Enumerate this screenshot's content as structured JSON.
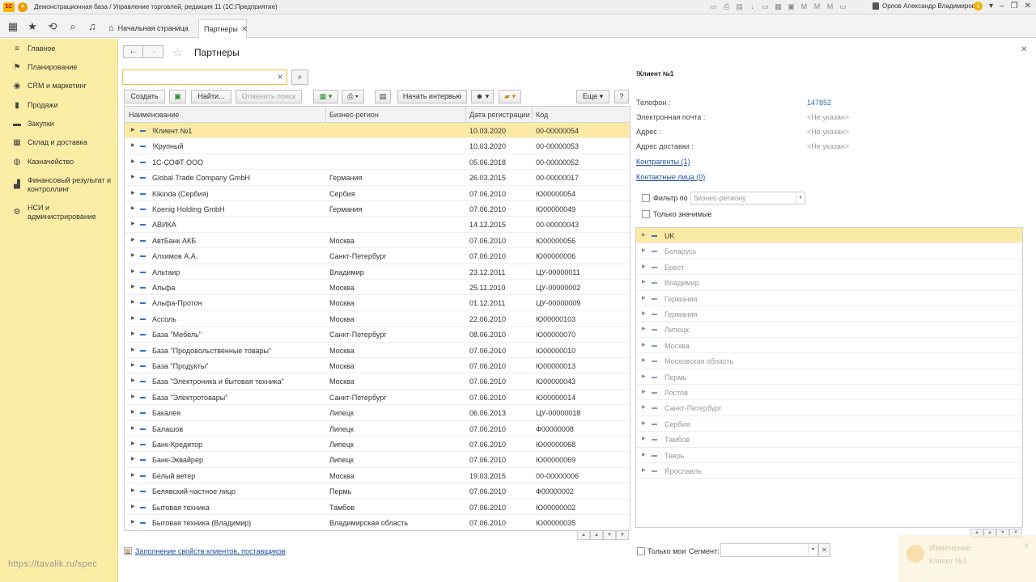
{
  "window": {
    "title": "Демонстрационная база / Управление торговлей, редакция 11  (1С:Предприятие)",
    "user": "Орлов Александр Владимирович"
  },
  "tabs": [
    {
      "label": "Начальная страница"
    },
    {
      "label": "Партнеры"
    }
  ],
  "sidebar": {
    "items": [
      {
        "label": "Главное",
        "icon": "menu-lines-icon"
      },
      {
        "label": "Планирование",
        "icon": "planning-icon"
      },
      {
        "label": "CRM и маркетинг",
        "icon": "crm-icon"
      },
      {
        "label": "Продажи",
        "icon": "sales-icon"
      },
      {
        "label": "Закупки",
        "icon": "purchases-icon"
      },
      {
        "label": "Склад и доставка",
        "icon": "warehouse-icon"
      },
      {
        "label": "Казначейство",
        "icon": "treasury-icon"
      },
      {
        "label": "Финансовый результат и контроллинг",
        "icon": "finance-icon"
      },
      {
        "label": "НСИ и администрирование",
        "icon": "settings-icon"
      }
    ],
    "watermark": "https://tavalik.ru/spec"
  },
  "form": {
    "title": "Партнеры",
    "search_value": "",
    "buttons": {
      "create": "Создать",
      "find": "Найти...",
      "cancel_search": "Отменить поиск",
      "start_interview": "Начать интервью",
      "more": "Еще",
      "help": "?"
    },
    "columns": [
      "Наименование",
      "Бизнес-регион",
      "Дата регистрации",
      "Код"
    ],
    "rows": [
      {
        "name": "!Клиент №1",
        "region": "",
        "date": "10.03.2020",
        "code": "00-00000054"
      },
      {
        "name": "!Крупный",
        "region": "",
        "date": "10.03.2020",
        "code": "00-00000053"
      },
      {
        "name": "1С-СОФТ ООО",
        "region": "",
        "date": "05.06.2018",
        "code": "00-00000052"
      },
      {
        "name": "Global Trade Company GmbH",
        "region": "Германия",
        "date": "26.03.2015",
        "code": "00-00000017"
      },
      {
        "name": "Kikinda (Сербия)",
        "region": "Сербия",
        "date": "07.06.2010",
        "code": "Ю00000054"
      },
      {
        "name": "Koenig Holding GmbH",
        "region": "Германия",
        "date": "07.06.2010",
        "code": "Ю00000049"
      },
      {
        "name": "АВИКА",
        "region": "",
        "date": "14.12.2015",
        "code": "00-00000043"
      },
      {
        "name": "АвтБанк АКБ",
        "region": "Москва",
        "date": "07.06.2010",
        "code": "Ю00000056"
      },
      {
        "name": "Алхимов А.А.",
        "region": "Санкт-Петербург",
        "date": "07.06.2010",
        "code": "Ю00000006"
      },
      {
        "name": "Альтаир",
        "region": "Владимир",
        "date": "23.12.2011",
        "code": "ЦУ-00000011"
      },
      {
        "name": "Альфа",
        "region": "Москва",
        "date": "25.11.2010",
        "code": "ЦУ-00000002"
      },
      {
        "name": "Альфа-Протон",
        "region": "Москва",
        "date": "01.12.2011",
        "code": "ЦУ-00000009"
      },
      {
        "name": "Ассоль",
        "region": "Москва",
        "date": "22.06.2010",
        "code": "Ю00000103"
      },
      {
        "name": "База \"Мебель\"",
        "region": "Санкт-Петербург",
        "date": "08.06.2010",
        "code": "Ю00000070"
      },
      {
        "name": "База \"Продовольственные товары\"",
        "region": "Москва",
        "date": "07.06.2010",
        "code": "Ю00000010"
      },
      {
        "name": "База \"Продукты\"",
        "region": "Москва",
        "date": "07.06.2010",
        "code": "Ю00000013"
      },
      {
        "name": "База \"Электроника и бытовая техника\"",
        "region": "Москва",
        "date": "07.06.2010",
        "code": "Ю00000043"
      },
      {
        "name": "База \"Электротовары\"",
        "region": "Санкт-Петербург",
        "date": "07.06.2010",
        "code": "Ю00000014"
      },
      {
        "name": "Бакалея",
        "region": "Липецк",
        "date": "06.06.2013",
        "code": "ЦУ-00000018"
      },
      {
        "name": "Балашов",
        "region": "Липецк",
        "date": "07.06.2010",
        "code": "Ф00000008"
      },
      {
        "name": "Банк-Кредитор",
        "region": "Липецк",
        "date": "07.06.2010",
        "code": "Ю00000068"
      },
      {
        "name": "Банк-Эквайрер",
        "region": "Липецк",
        "date": "07.06.2010",
        "code": "Ю00000069"
      },
      {
        "name": "Белый ветер",
        "region": "Москва",
        "date": "19.03.2015",
        "code": "00-00000006"
      },
      {
        "name": "Белявский-частное лицо",
        "region": "Пермь",
        "date": "07.06.2010",
        "code": "Ф00000002"
      },
      {
        "name": "Бытовая техника",
        "region": "Тамбов",
        "date": "07.06.2010",
        "code": "Ю00000002"
      },
      {
        "name": "Бытовая техника (Владимир)",
        "region": "Владимирская область",
        "date": "07.06.2010",
        "code": "Ю00000035"
      }
    ],
    "bottom_link": "Заполнение свойств клиентов, поставщиков"
  },
  "details": {
    "title": "!Клиент №1",
    "fields": [
      {
        "label": "Телефон :",
        "value": "147852"
      },
      {
        "label": "Электронная почта :",
        "value": "<Не указан>"
      },
      {
        "label": "Адрес :",
        "value": "<Не указан>"
      },
      {
        "label": "Адрес доставки :",
        "value": "<Не указан>"
      }
    ],
    "links": [
      "Контрагенты (1)",
      "Контактные лица (0)"
    ],
    "filter_label": "Фильтр по",
    "filter_select": "бизнес-региону",
    "only_significant": "Только значимые",
    "regions": [
      "UK",
      "Беларусь",
      "Брест",
      "Владимир",
      "Германия",
      "Германия",
      "Липецк",
      "Москва",
      "Московская область",
      "Пермь",
      "Ростов",
      "Санкт-Петербург",
      "Сербия",
      "Тамбов",
      "Тверь",
      "Ярославль"
    ],
    "only_mine": "Только мои",
    "segment_label": "Сегмент:"
  },
  "notification": {
    "title": "Изменение",
    "subtitle": "Клиент №1"
  },
  "colors": {
    "sidebar_bg": "#fbeda5",
    "selection": "#fbeaa6",
    "link": "#1f4e99",
    "accent": "#f0c040"
  }
}
